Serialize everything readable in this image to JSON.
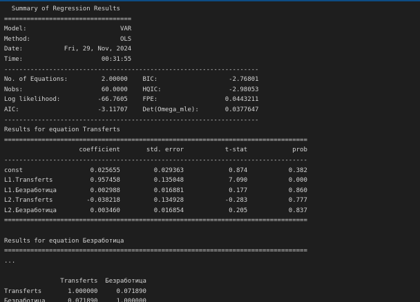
{
  "output": {
    "lines": [
      "  Summary of Regression Results",
      "==================================",
      "Model:                         VAR",
      "Method:                        OLS",
      "Date:           Fri, 29, Nov, 2024",
      "Time:                     00:31:55",
      "--------------------------------------------------------------------",
      "No. of Equations:         2.00000    BIC:                   -2.76801",
      "Nobs:                     60.0000    HQIC:                  -2.98053",
      "Log likelihood:          -66.7605    FPE:                  0.0443211",
      "AIC:                     -3.11707    Det(Omega_mle):       0.0377647",
      "--------------------------------------------------------------------",
      "Results for equation Transferts",
      "=================================================================================",
      "                    coefficient       std. error           t-stat            prob",
      "---------------------------------------------------------------------------------",
      "const                  0.025655         0.029363            0.874           0.382",
      "L1.Transferts          0.957458         0.135048            7.090           0.000",
      "L1.Безработица         0.002988         0.016881            0.177           0.860",
      "L2.Transferts         -0.038218         0.134928           -0.283           0.777",
      "L2.Безработица         0.003460         0.016854            0.205           0.837",
      "=================================================================================",
      "",
      "Results for equation Безработица",
      "=================================================================================",
      "...",
      "",
      "               Transferts  Безработица",
      "Transferts       1.000000     0.071890",
      "Безработица      0.071890     1.000000"
    ]
  }
}
